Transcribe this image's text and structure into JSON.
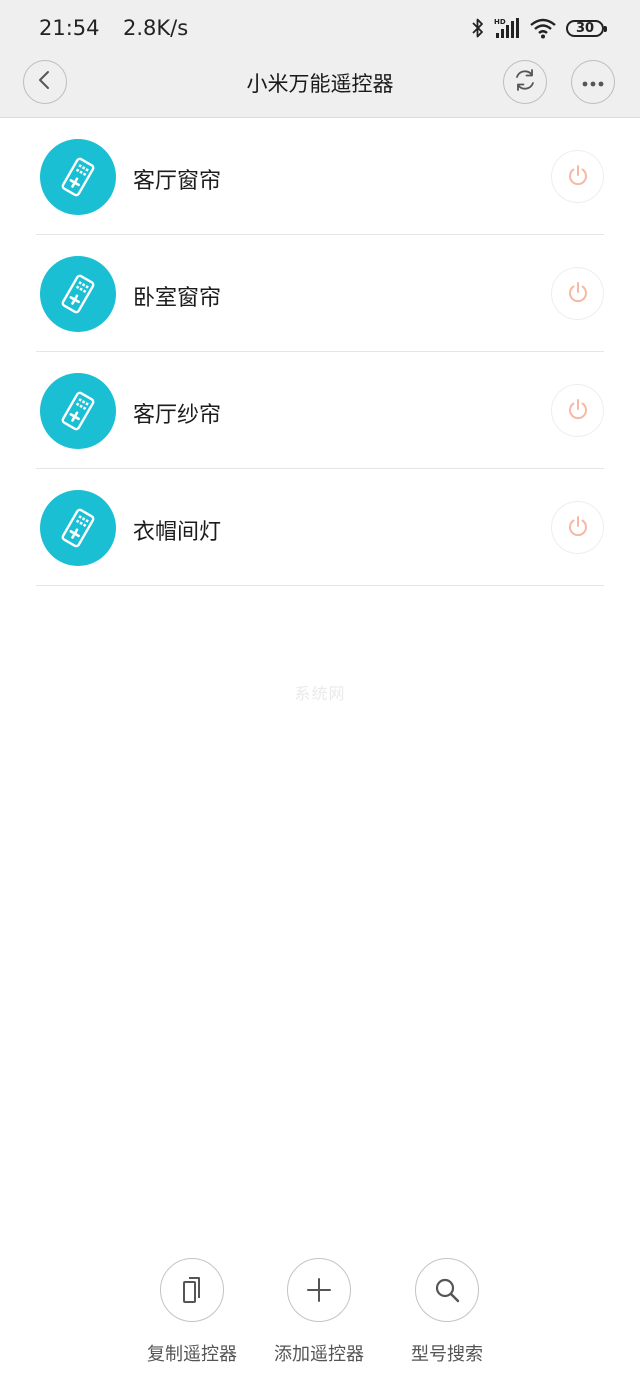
{
  "status_bar": {
    "time": "21:54",
    "network_speed": "2.8K/s",
    "battery": "30",
    "icons": [
      "bluetooth-icon",
      "hd-signal-icon",
      "wifi-icon",
      "battery-icon"
    ]
  },
  "header": {
    "title": "小米万能遥控器",
    "back_icon": "chevron-left-icon",
    "sync_icon": "sync-icon",
    "more_icon": "more-dots-icon"
  },
  "devices": [
    {
      "name": "客厅窗帘",
      "icon": "remote-control-icon",
      "power_icon": "power-icon"
    },
    {
      "name": "卧室窗帘",
      "icon": "remote-control-icon",
      "power_icon": "power-icon"
    },
    {
      "name": "客厅纱帘",
      "icon": "remote-control-icon",
      "power_icon": "power-icon"
    },
    {
      "name": "衣帽间灯",
      "icon": "remote-control-icon",
      "power_icon": "power-icon"
    }
  ],
  "watermark": "系统网",
  "bottom_actions": [
    {
      "label": "复制遥控器",
      "icon": "copy-icon"
    },
    {
      "label": "添加遥控器",
      "icon": "plus-icon"
    },
    {
      "label": "型号搜索",
      "icon": "search-icon"
    }
  ],
  "colors": {
    "accent": "#1bbfd3",
    "power": "#f7b9a3",
    "header_bg": "#efefef"
  }
}
